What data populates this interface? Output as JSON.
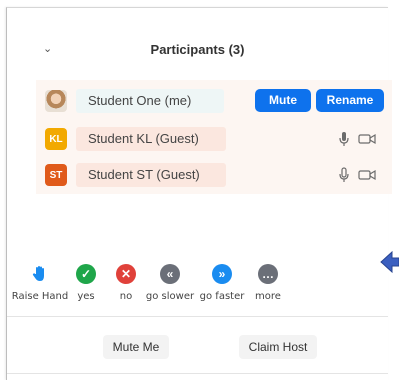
{
  "header": {
    "title": "Participants",
    "count": "(3)"
  },
  "participants": [
    {
      "name": "Student One (me)",
      "initials": "",
      "avatar_color": "#d4b08a",
      "actions": [
        "Mute",
        "Rename"
      ]
    },
    {
      "name": "Student KL (Guest)",
      "initials": "KL",
      "avatar_color": "#f2a900"
    },
    {
      "name": "Student ST (Guest)",
      "initials": "ST",
      "avatar_color": "#e05a1a"
    }
  ],
  "row_actions": {
    "mute_label": "Mute",
    "rename_label": "Rename"
  },
  "reactions": [
    {
      "label": "Raise Hand",
      "icon": "hand-icon",
      "color": "#1a8cf0"
    },
    {
      "label": "yes",
      "icon": "check-icon",
      "color": "#1fa64a"
    },
    {
      "label": "no",
      "icon": "x-icon",
      "color": "#e0413a"
    },
    {
      "label": "go slower",
      "icon": "rewind-icon",
      "color": "#6b6f78"
    },
    {
      "label": "go faster",
      "icon": "fast-forward-icon",
      "color": "#1a8cf0"
    },
    {
      "label": "more",
      "icon": "more-icon",
      "color": "#6b6f78"
    }
  ],
  "footer": {
    "mute_me_label": "Mute Me",
    "claim_host_label": "Claim Host"
  },
  "colors": {
    "accent": "#0e72ed",
    "row_highlight": "#fbe7df",
    "arrow": "#3b5fc0"
  }
}
